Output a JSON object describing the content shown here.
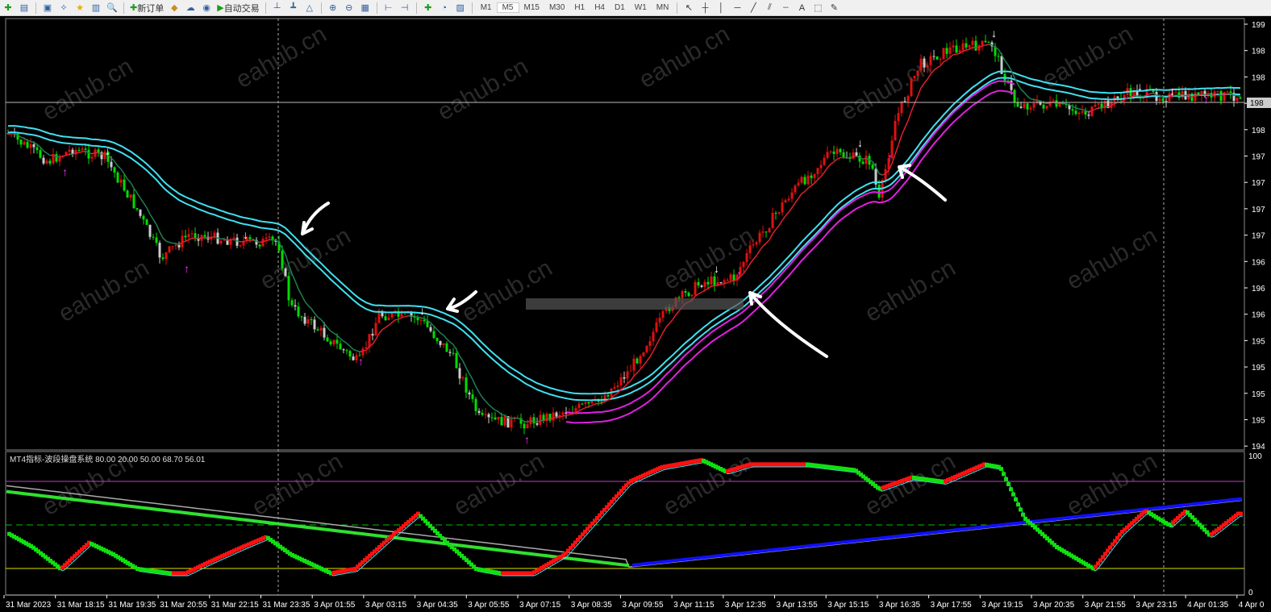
{
  "toolbar": {
    "icons": [
      "new-chart-icon",
      "profiles-icon",
      "market-watch-icon",
      "navigator-icon",
      "favorites-icon",
      "terminal-icon",
      "strategy-tester-icon",
      "new-order-icon",
      "metaeditor-icon",
      "chat-icon",
      "signals-icon",
      "autotrading-icon",
      "bar-chart-icon",
      "candlestick-icon",
      "line-chart-icon",
      "zoom-in-icon",
      "zoom-out-icon",
      "tile-icon",
      "auto-scroll-icon",
      "chart-shift-icon",
      "indicators-icon",
      "periods-icon",
      "templates-icon"
    ],
    "new_order_label": "新订单",
    "autotrading_label": "自动交易",
    "timeframes": [
      "M1",
      "M5",
      "M15",
      "M30",
      "H1",
      "H4",
      "D1",
      "W1",
      "MN"
    ],
    "active_timeframe": "M5",
    "drawing_tools": [
      "cursor-icon",
      "crosshair-icon",
      "vertical-line-icon",
      "horizontal-line-icon",
      "trendline-icon",
      "fibo-icon",
      "fibo-fan-icon",
      "text-icon",
      "label-icon",
      "shapes-icon"
    ],
    "text_tool_label": "A"
  },
  "price_axis": {
    "labels": [
      "199",
      "198",
      "198",
      "198",
      "198",
      "197",
      "197",
      "197",
      "197",
      "196",
      "196",
      "196",
      "195",
      "195",
      "195",
      "195",
      "194"
    ],
    "current_price_label": "198"
  },
  "indicator": {
    "title": "MT4指标-波段操盘系统 80.00 20.00 50.00 68.70 56.01",
    "axis_max": "100",
    "axis_min": "0",
    "levels": [
      80,
      20,
      50
    ]
  },
  "time_axis": {
    "labels": [
      "31 Mar 2023",
      "31 Mar 18:15",
      "31 Mar 19:35",
      "31 Mar 20:55",
      "31 Mar 22:15",
      "31 Mar 23:35",
      "3 Apr 01:55",
      "3 Apr 03:15",
      "3 Apr 04:35",
      "3 Apr 05:55",
      "3 Apr 07:15",
      "3 Apr 08:35",
      "3 Apr 09:55",
      "3 Apr 11:15",
      "3 Apr 12:35",
      "3 Apr 13:55",
      "3 Apr 15:15",
      "3 Apr 16:35",
      "3 Apr 17:55",
      "3 Apr 19:15",
      "3 Apr 20:35",
      "3 Apr 21:55",
      "3 Apr 23:15",
      "4 Apr 01:35",
      "4 Apr 0"
    ]
  },
  "watermark": "eahub.cn",
  "colors": {
    "bull": "#e01010",
    "bear": "#00dd00",
    "cyan": "#40e0f0",
    "magenta": "#e020e0",
    "blue": "#1010ff",
    "level80": "#c040c0",
    "level50": "#00c000",
    "level20": "#e0e000"
  }
}
